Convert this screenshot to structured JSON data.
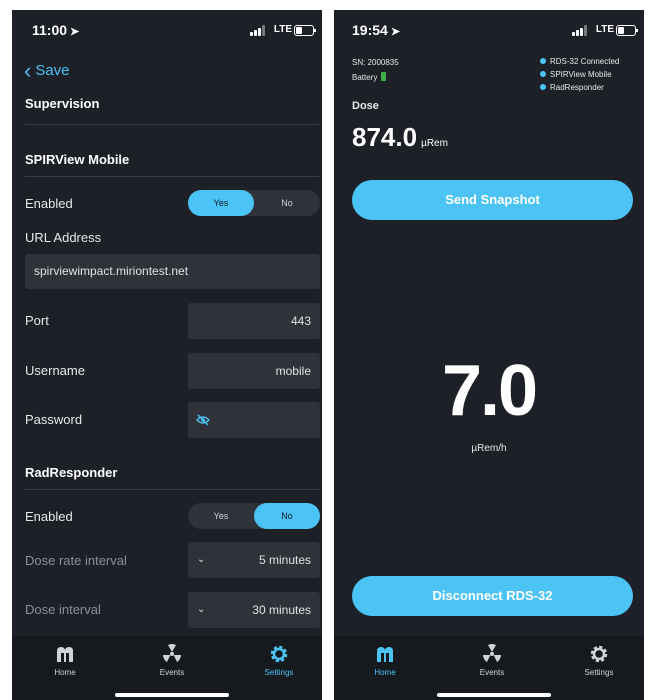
{
  "left": {
    "status": {
      "time": "11:00",
      "network": "LTE"
    },
    "nav": {
      "back_label": "Save"
    },
    "supervision_title": "Supervision",
    "spirview": {
      "title": "SPIRView Mobile",
      "enabled_label": "Enabled",
      "yes_label": "Yes",
      "no_label": "No",
      "selected": "Yes",
      "url_label": "URL Address",
      "url_value": "spirviewimpact.miriontest.net",
      "port_label": "Port",
      "port_value": "443",
      "username_label": "Username",
      "username_value": "mobile",
      "password_label": "Password"
    },
    "radresponder": {
      "title": "RadResponder",
      "enabled_label": "Enabled",
      "yes_label": "Yes",
      "no_label": "No",
      "selected": "No",
      "dose_rate_interval_label": "Dose rate interval",
      "dose_rate_interval_value": "5 minutes",
      "dose_interval_label": "Dose interval",
      "dose_interval_value": "30 minutes"
    },
    "tabs": [
      {
        "label": "Home",
        "icon": "home-m-icon"
      },
      {
        "label": "Events",
        "icon": "radiation-icon"
      },
      {
        "label": "Settings",
        "icon": "gear-icon"
      }
    ],
    "active_tab": "Settings"
  },
  "right": {
    "status": {
      "time": "19:54",
      "network": "LTE"
    },
    "serial": "SN: 2000835",
    "battery_label": "Battery",
    "connections": [
      "RDS-32 Connected",
      "SPIRView Mobile",
      "RadResponder"
    ],
    "dose_label": "Dose",
    "dose_value": "874.0",
    "dose_unit": "µRem",
    "snapshot_button": "Send Snapshot",
    "rate_value": "7.0",
    "rate_unit": "µRem/h",
    "disconnect_button": "Disconnect RDS-32",
    "tabs": [
      {
        "label": "Home",
        "icon": "home-m-icon"
      },
      {
        "label": "Events",
        "icon": "radiation-icon"
      },
      {
        "label": "Settings",
        "icon": "gear-icon"
      }
    ],
    "active_tab": "Home"
  },
  "colors": {
    "accent": "#4cc3f5",
    "background": "#1d2026",
    "field": "#2f3339",
    "battery_green": "#3fae49"
  }
}
